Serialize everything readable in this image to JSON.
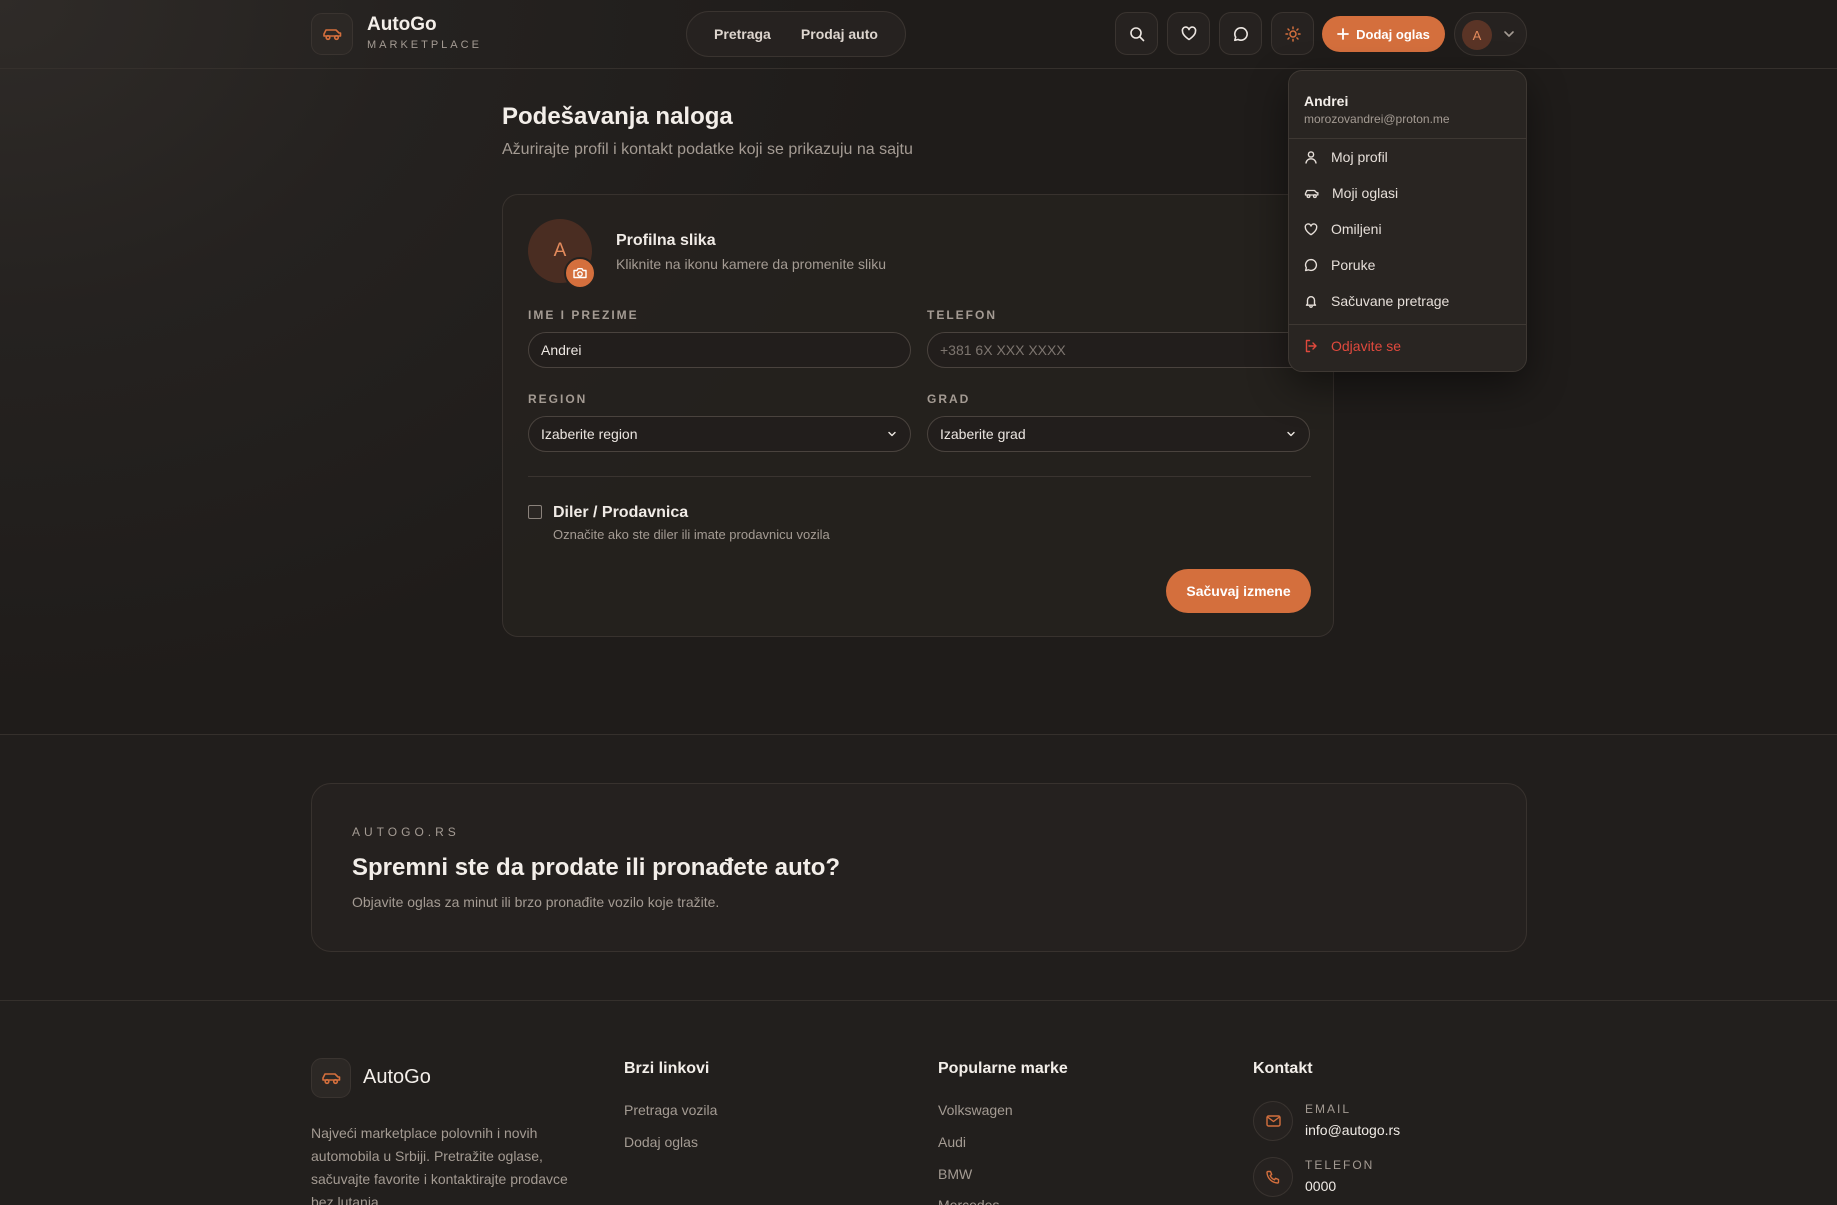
{
  "brand": {
    "name": "AutoGo",
    "tagline": "MARKETPLACE"
  },
  "nav": {
    "items": [
      "Pretraga",
      "Prodaj auto"
    ]
  },
  "header": {
    "icons": [
      "search-icon",
      "heart-icon",
      "chat-icon",
      "sun-icon"
    ],
    "add_listing_label": "Dodaj oglas",
    "avatar_letter": "A"
  },
  "page": {
    "title": "Podešavanja naloga",
    "subtitle": "Ažurirajte profil i kontakt podatke koji se prikazuju na sajtu"
  },
  "profile": {
    "avatar_letter": "A",
    "title": "Profilna slika",
    "subtitle": "Kliknite na ikonu kamere da promenite sliku"
  },
  "form": {
    "name": {
      "label": "IME I PREZIME",
      "value": "Andrei"
    },
    "phone": {
      "label": "TELEFON",
      "placeholder": "+381 6X XXX XXXX"
    },
    "region": {
      "label": "REGION",
      "selected": "Izaberite region"
    },
    "city": {
      "label": "GRAD",
      "selected": "Izaberite grad"
    },
    "dealer": {
      "title": "Diler / Prodavnica",
      "subtitle": "Označite ako ste diler ili imate prodavnicu vozila",
      "checked": false
    },
    "save_label": "Sačuvaj izmene"
  },
  "user_menu": {
    "name": "Andrei",
    "email": "morozovandrei@proton.me",
    "items": [
      {
        "label": "Moj profil",
        "icon": "user-icon"
      },
      {
        "label": "Moji oglasi",
        "icon": "car-icon"
      },
      {
        "label": "Omiljeni",
        "icon": "heart-icon"
      },
      {
        "label": "Poruke",
        "icon": "chat-icon"
      },
      {
        "label": "Sačuvane pretrage",
        "icon": "bell-icon"
      }
    ],
    "logout_label": "Odjavite se"
  },
  "cta": {
    "eyebrow": "AUTOGO.RS",
    "title": "Spremni ste da prodate ili pronađete auto?",
    "subtitle": "Objavite oglas za minut ili brzo pronađite vozilo koje tražite."
  },
  "footer": {
    "brand": "AutoGo",
    "description": "Najveći marketplace polovnih i novih automobila u Srbiji. Pretražite oglase, sačuvajte favorite i kontaktirajte prodavce bez lutanja.",
    "quick_links": {
      "title": "Brzi linkovi",
      "items": [
        "Pretraga vozila",
        "Dodaj oglas"
      ]
    },
    "brands": {
      "title": "Popularne marke",
      "items": [
        "Volkswagen",
        "Audi",
        "BMW",
        "Mercedes"
      ]
    },
    "contact": {
      "title": "Kontakt",
      "email_label": "EMAIL",
      "email": "info@autogo.rs",
      "phone_label": "TELEFON",
      "phone": "0000"
    }
  },
  "colors": {
    "accent": "#d46f3d",
    "danger": "#e0493d",
    "background": "#211e1c"
  }
}
